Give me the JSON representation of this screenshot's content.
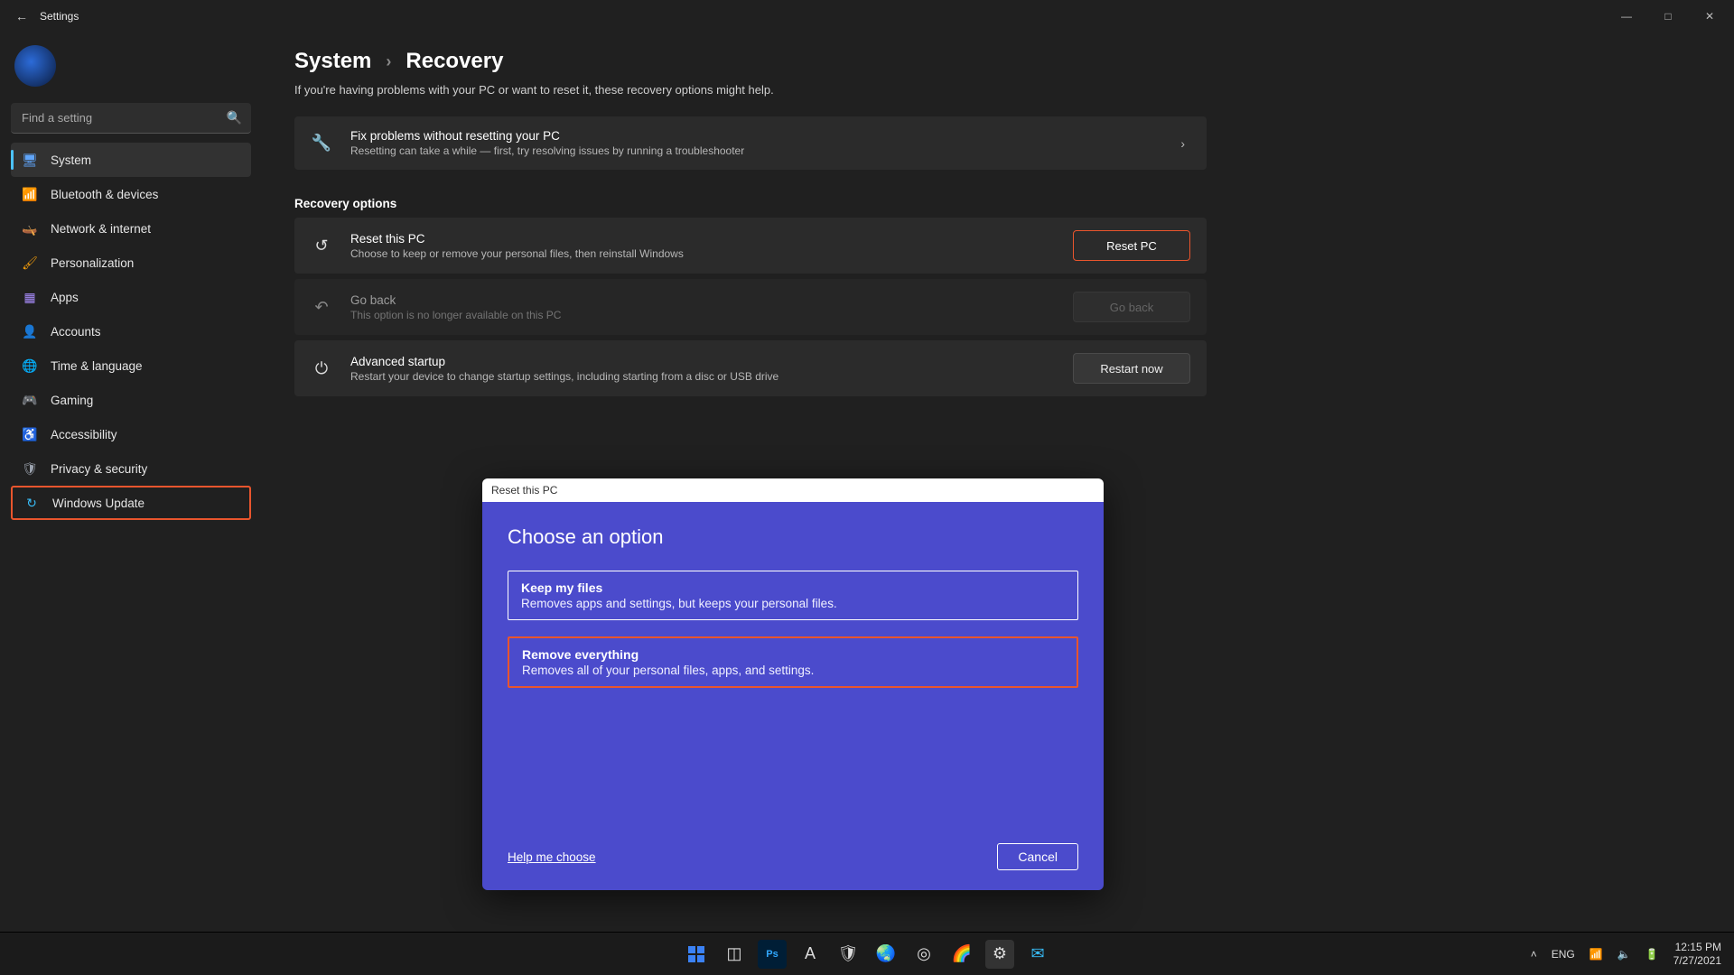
{
  "window": {
    "title": "Settings"
  },
  "search": {
    "placeholder": "Find a setting"
  },
  "nav": {
    "items": [
      {
        "label": "System"
      },
      {
        "label": "Bluetooth & devices"
      },
      {
        "label": "Network & internet"
      },
      {
        "label": "Personalization"
      },
      {
        "label": "Apps"
      },
      {
        "label": "Accounts"
      },
      {
        "label": "Time & language"
      },
      {
        "label": "Gaming"
      },
      {
        "label": "Accessibility"
      },
      {
        "label": "Privacy & security"
      },
      {
        "label": "Windows Update"
      }
    ]
  },
  "breadcrumb": {
    "root": "System",
    "leaf": "Recovery"
  },
  "page": {
    "subtitle": "If you're having problems with your PC or want to reset it, these recovery options might help.",
    "fix": {
      "title": "Fix problems without resetting your PC",
      "desc": "Resetting can take a while — first, try resolving issues by running a troubleshooter"
    },
    "section_title": "Recovery options",
    "reset": {
      "title": "Reset this PC",
      "desc": "Choose to keep or remove your personal files, then reinstall Windows",
      "button": "Reset PC"
    },
    "goback": {
      "title": "Go back",
      "desc": "This option is no longer available on this PC",
      "button": "Go back"
    },
    "adv": {
      "title": "Advanced startup",
      "desc": "Restart your device to change startup settings, including starting from a disc or USB drive",
      "button": "Restart now"
    }
  },
  "dialog": {
    "titlebar": "Reset this PC",
    "heading": "Choose an option",
    "options": [
      {
        "title": "Keep my files",
        "desc": "Removes apps and settings, but keeps your personal files."
      },
      {
        "title": "Remove everything",
        "desc": "Removes all of your personal files, apps, and settings."
      }
    ],
    "help": "Help me choose",
    "cancel": "Cancel"
  },
  "taskbar": {
    "lang": "ENG",
    "time": "12:15 PM",
    "date": "7/27/2021"
  }
}
